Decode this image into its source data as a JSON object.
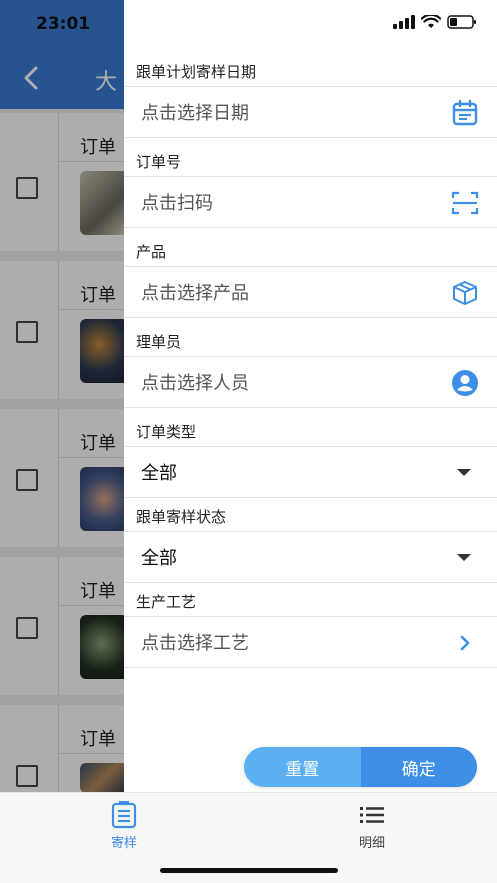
{
  "status_bar": {
    "time": "23:01"
  },
  "background_page": {
    "title": "大",
    "cards": [
      {
        "title": "订单"
      },
      {
        "title": "订单"
      },
      {
        "title": "订单"
      },
      {
        "title": "订单"
      },
      {
        "title": "订单"
      }
    ]
  },
  "filter": {
    "date": {
      "label": "跟单计划寄样日期",
      "placeholder": "点击选择日期",
      "icon": "calendar-icon"
    },
    "order_no": {
      "label": "订单号",
      "placeholder": "点击扫码",
      "icon": "scan-icon"
    },
    "product": {
      "label": "产品",
      "placeholder": "点击选择产品",
      "icon": "box-icon"
    },
    "merchandiser": {
      "label": "理单员",
      "placeholder": "点击选择人员",
      "icon": "person-icon"
    },
    "order_type": {
      "label": "订单类型",
      "value": "全部"
    },
    "sample_status": {
      "label": "跟单寄样状态",
      "value": "全部"
    },
    "process": {
      "label": "生产工艺",
      "placeholder": "点击选择工艺",
      "icon": "chevron-right-icon"
    },
    "reset_label": "重置",
    "confirm_label": "确定"
  },
  "tabbar": {
    "tabs": [
      {
        "label": "寄样",
        "icon": "document-list-icon",
        "active": true
      },
      {
        "label": "明细",
        "icon": "list-icon",
        "active": false
      }
    ]
  },
  "colors": {
    "accent": "#3d8fe6",
    "header": "#3a7dd6",
    "reset": "#5ab0f2"
  }
}
